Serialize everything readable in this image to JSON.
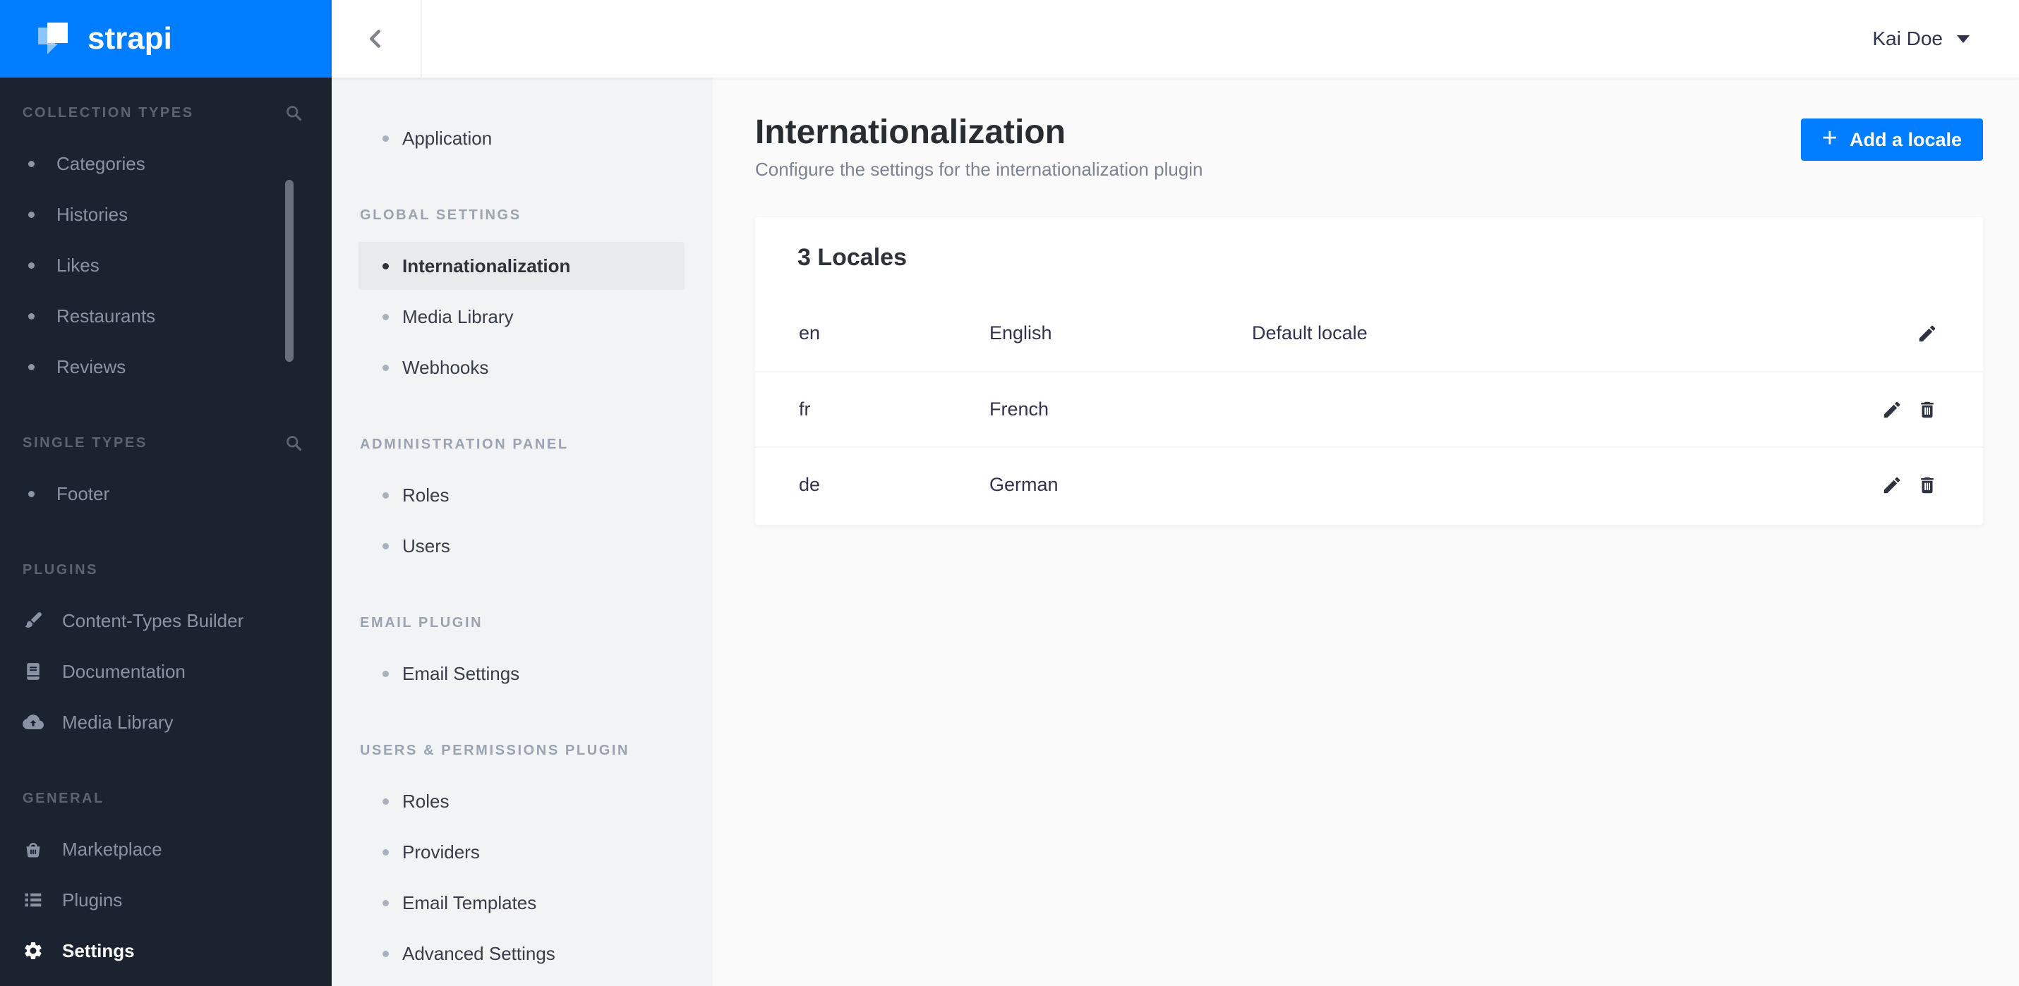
{
  "colors": {
    "primary_blue": "#007eff",
    "sidebar_bg": "#1c2330",
    "subnav_bg": "#f2f3f4",
    "main_bg": "#fafafb",
    "active_item_bg": "#e9eaeb",
    "dark_text": "#32324d"
  },
  "logo": {
    "wordmark": "strapi"
  },
  "topbar": {
    "user": {
      "name": "Kai Doe"
    }
  },
  "sidebar": {
    "sections": [
      {
        "label": "COLLECTION TYPES",
        "has_search": true,
        "items": [
          {
            "label": "Categories"
          },
          {
            "label": "Histories"
          },
          {
            "label": "Likes"
          },
          {
            "label": "Restaurants"
          },
          {
            "label": "Reviews"
          }
        ]
      },
      {
        "label": "SINGLE TYPES",
        "has_search": true,
        "items": [
          {
            "label": "Footer"
          }
        ]
      },
      {
        "label": "PLUGINS",
        "has_search": false,
        "items": [
          {
            "label": "Content-Types Builder",
            "icon": "paintbrush-icon"
          },
          {
            "label": "Documentation",
            "icon": "book-icon"
          },
          {
            "label": "Media Library",
            "icon": "cloud-upload-icon"
          }
        ]
      },
      {
        "label": "GENERAL",
        "has_search": false,
        "items": [
          {
            "label": "Marketplace",
            "icon": "basket-icon"
          },
          {
            "label": "Plugins",
            "icon": "list-icon"
          },
          {
            "label": "Settings",
            "icon": "gear-icon",
            "active": true
          }
        ]
      }
    ]
  },
  "settings_nav": {
    "top_item": {
      "label": "Application"
    },
    "sections": [
      {
        "label": "GLOBAL SETTINGS",
        "items": [
          {
            "label": "Internationalization",
            "active": true
          },
          {
            "label": "Media Library"
          },
          {
            "label": "Webhooks"
          }
        ]
      },
      {
        "label": "ADMINISTRATION PANEL",
        "items": [
          {
            "label": "Roles"
          },
          {
            "label": "Users"
          }
        ]
      },
      {
        "label": "EMAIL PLUGIN",
        "items": [
          {
            "label": "Email Settings"
          }
        ]
      },
      {
        "label": "USERS & PERMISSIONS PLUGIN",
        "items": [
          {
            "label": "Roles"
          },
          {
            "label": "Providers"
          },
          {
            "label": "Email Templates"
          },
          {
            "label": "Advanced Settings"
          }
        ]
      }
    ]
  },
  "page": {
    "title": "Internationalization",
    "subtitle": "Configure the settings for the internationalization plugin",
    "add_locale_button": {
      "plus": "+",
      "label": "Add a locale",
      "icon": "plus-icon"
    },
    "card": {
      "title": "3 Locales",
      "rows": [
        {
          "code": "en",
          "name": "English",
          "note": "Default locale",
          "can_delete": false
        },
        {
          "code": "fr",
          "name": "French",
          "note": "",
          "can_delete": true
        },
        {
          "code": "de",
          "name": "German",
          "note": "",
          "can_delete": true
        }
      ]
    }
  }
}
